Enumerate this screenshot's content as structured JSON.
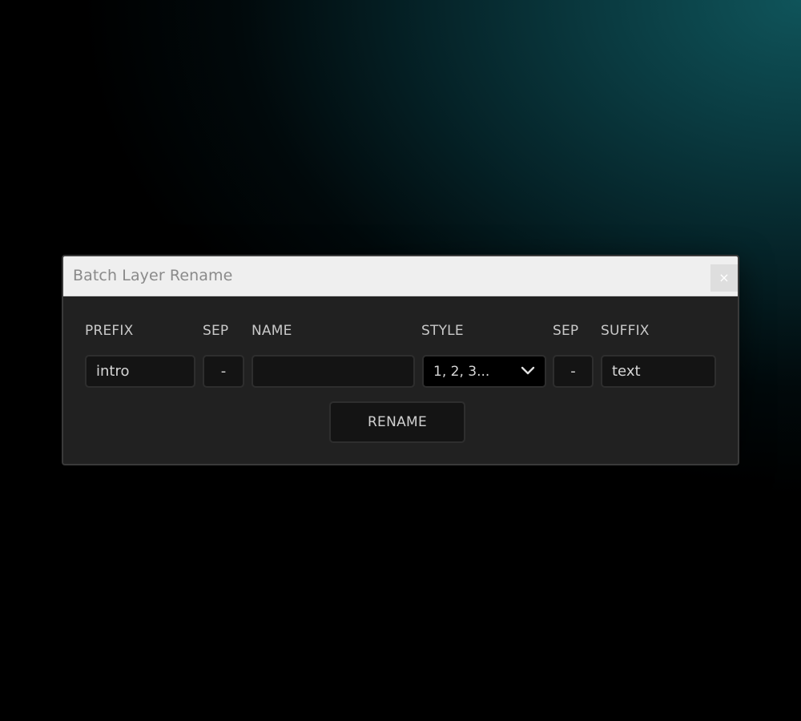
{
  "dialog": {
    "title": "Batch Layer Rename",
    "close_glyph": "×",
    "close_icon": "close-icon"
  },
  "labels": {
    "prefix": "PREFIX",
    "sep1": "SEP",
    "name": "NAME",
    "style": "STYLE",
    "sep2": "SEP",
    "suffix": "SUFFIX"
  },
  "fields": {
    "prefix_value": "intro",
    "sep1_value": "-",
    "name_value": "",
    "style_value": "1, 2, 3...",
    "style_icon": "chevron-down-icon",
    "sep2_value": "-",
    "suffix_value": "text"
  },
  "actions": {
    "rename_label": "RENAME"
  },
  "colors": {
    "background_accent": "#0f545a",
    "dialog_bg": "#212121",
    "titlebar_bg": "#efefef",
    "field_bg": "#141414"
  }
}
